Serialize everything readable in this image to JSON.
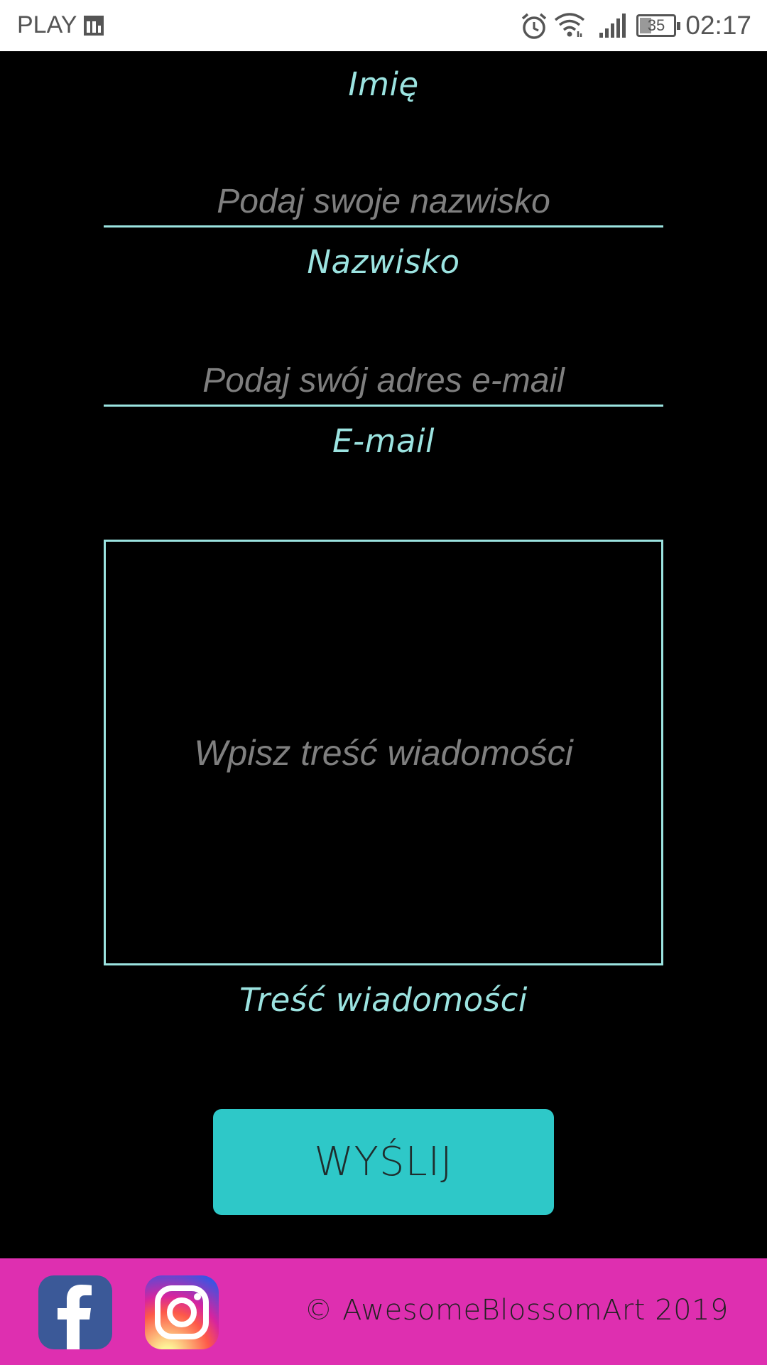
{
  "status_bar": {
    "carrier": "PLAY",
    "battery": "35",
    "time": "02:17",
    "icons": [
      "carrier-icon",
      "alarm-icon",
      "wifi-icon",
      "signal-icon",
      "battery-icon"
    ]
  },
  "form": {
    "first_name": {
      "label": "Imię"
    },
    "last_name": {
      "placeholder": "Podaj swoje nazwisko",
      "label": "Nazwisko"
    },
    "email": {
      "placeholder": "Podaj swój adres e-mail",
      "label": "E-mail"
    },
    "message": {
      "placeholder": "Wpisz treść wiadomości",
      "label": "Treść wiadomości"
    },
    "submit_label": "WYŚLIJ"
  },
  "footer": {
    "copyright": "© AwesomeBlossomArt 2019",
    "icons": [
      "facebook-icon",
      "instagram-icon"
    ]
  },
  "colors": {
    "accent": "#9be3e0",
    "button": "#2ec8c8",
    "footer": "#de2fb0",
    "background": "#000000"
  }
}
